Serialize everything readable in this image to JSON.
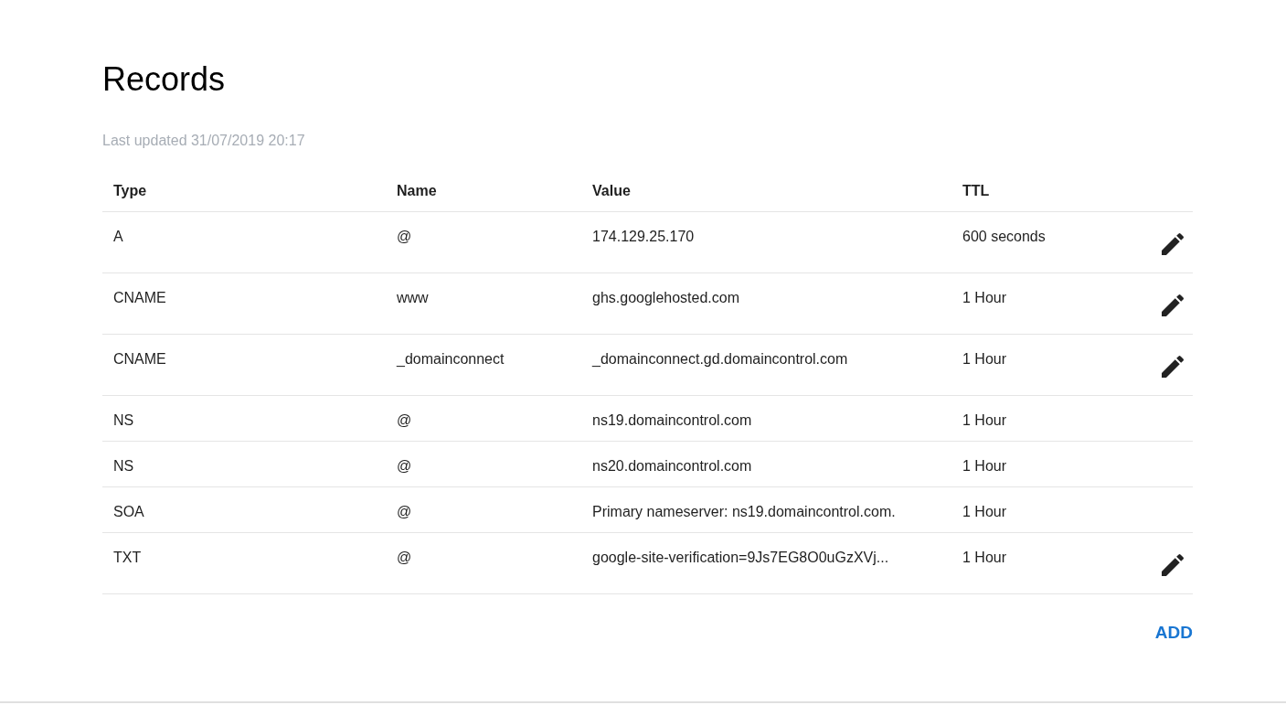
{
  "title": "Records",
  "last_updated": "Last updated 31/07/2019 20:17",
  "table": {
    "columns": [
      "Type",
      "Name",
      "Value",
      "TTL"
    ],
    "rows": [
      {
        "type": "A",
        "name": "@",
        "value": "174.129.25.170",
        "ttl": "600 seconds",
        "editable": true
      },
      {
        "type": "CNAME",
        "name": "www",
        "value": "ghs.googlehosted.com",
        "ttl": "1 Hour",
        "editable": true
      },
      {
        "type": "CNAME",
        "name": "_domainconnect",
        "value": "_domainconnect.gd.domaincontrol.com",
        "ttl": "1 Hour",
        "editable": true
      },
      {
        "type": "NS",
        "name": "@",
        "value": "ns19.domaincontrol.com",
        "ttl": "1 Hour",
        "editable": false
      },
      {
        "type": "NS",
        "name": "@",
        "value": "ns20.domaincontrol.com",
        "ttl": "1 Hour",
        "editable": false
      },
      {
        "type": "SOA",
        "name": "@",
        "value": "Primary nameserver: ns19.domaincontrol.com.",
        "ttl": "1 Hour",
        "editable": false
      },
      {
        "type": "TXT",
        "name": "@",
        "value": "google-site-verification=9Js7EG8O0uGzXVj...",
        "ttl": "1 Hour",
        "editable": true
      }
    ]
  },
  "add_button": "ADD"
}
